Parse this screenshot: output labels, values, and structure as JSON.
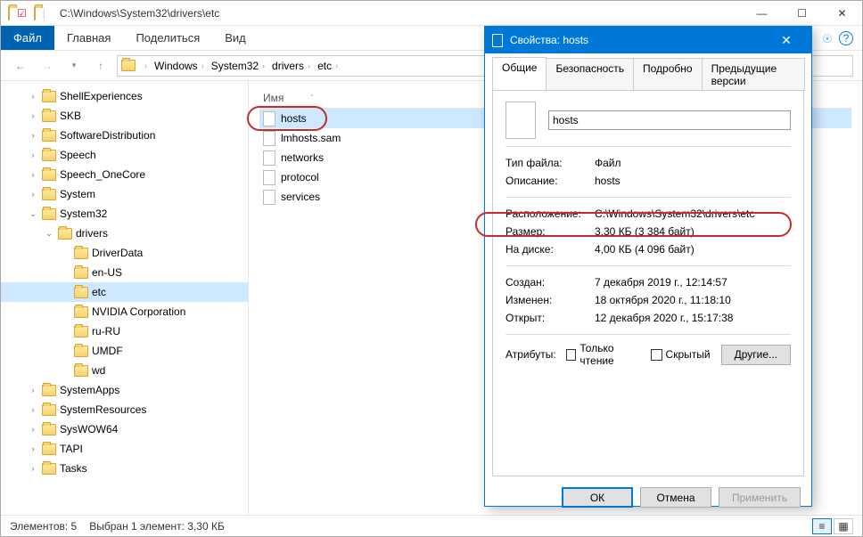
{
  "titlebar": {
    "path": "C:\\Windows\\System32\\drivers\\etc"
  },
  "ribbon": {
    "file": "Файл",
    "tabs": [
      "Главная",
      "Поделиться",
      "Вид"
    ]
  },
  "breadcrumbs": [
    "Windows",
    "System32",
    "drivers",
    "etc"
  ],
  "tree": [
    {
      "label": "ShellExperiences",
      "lvl": 1
    },
    {
      "label": "SKB",
      "lvl": 1
    },
    {
      "label": "SoftwareDistribution",
      "lvl": 1
    },
    {
      "label": "Speech",
      "lvl": 1
    },
    {
      "label": "Speech_OneCore",
      "lvl": 1
    },
    {
      "label": "System",
      "lvl": 1
    },
    {
      "label": "System32",
      "lvl": 1,
      "expanded": true
    },
    {
      "label": "drivers",
      "lvl": 2,
      "expanded": true
    },
    {
      "label": "DriverData",
      "lvl": 3
    },
    {
      "label": "en-US",
      "lvl": 3
    },
    {
      "label": "etc",
      "lvl": 3,
      "selected": true
    },
    {
      "label": "NVIDIA Corporation",
      "lvl": 3
    },
    {
      "label": "ru-RU",
      "lvl": 3
    },
    {
      "label": "UMDF",
      "lvl": 3
    },
    {
      "label": "wd",
      "lvl": 3
    },
    {
      "label": "SystemApps",
      "lvl": 1
    },
    {
      "label": "SystemResources",
      "lvl": 1
    },
    {
      "label": "SysWOW64",
      "lvl": 1
    },
    {
      "label": "TAPI",
      "lvl": 1
    },
    {
      "label": "Tasks",
      "lvl": 1
    }
  ],
  "list": {
    "header": "Имя",
    "items": [
      {
        "name": "hosts",
        "selected": true
      },
      {
        "name": "lmhosts.sam"
      },
      {
        "name": "networks"
      },
      {
        "name": "protocol"
      },
      {
        "name": "services"
      }
    ]
  },
  "status": {
    "count": "Элементов: 5",
    "selection": "Выбран 1 элемент: 3,30 КБ"
  },
  "dialog": {
    "title": "Свойства: hosts",
    "tabs": [
      "Общие",
      "Безопасность",
      "Подробно",
      "Предыдущие версии"
    ],
    "filename": "hosts",
    "rows": {
      "type_k": "Тип файла:",
      "type_v": "Файл",
      "desc_k": "Описание:",
      "desc_v": "hosts",
      "loc_k": "Расположение:",
      "loc_v": "C:\\Windows\\System32\\drivers\\etc",
      "size_k": "Размер:",
      "size_v": "3,30 КБ (3 384 байт)",
      "disk_k": "На диске:",
      "disk_v": "4,00 КБ (4 096 байт)",
      "created_k": "Создан:",
      "created_v": "7 декабря 2019 г., 12:14:57",
      "modified_k": "Изменен:",
      "modified_v": "18 октября 2020 г., 11:18:10",
      "opened_k": "Открыт:",
      "opened_v": "12 декабря 2020 г., 15:17:38",
      "attr_k": "Атрибуты:",
      "readonly": "Только чтение",
      "hidden": "Скрытый",
      "other": "Другие..."
    },
    "buttons": {
      "ok": "ОК",
      "cancel": "Отмена",
      "apply": "Применить"
    }
  }
}
